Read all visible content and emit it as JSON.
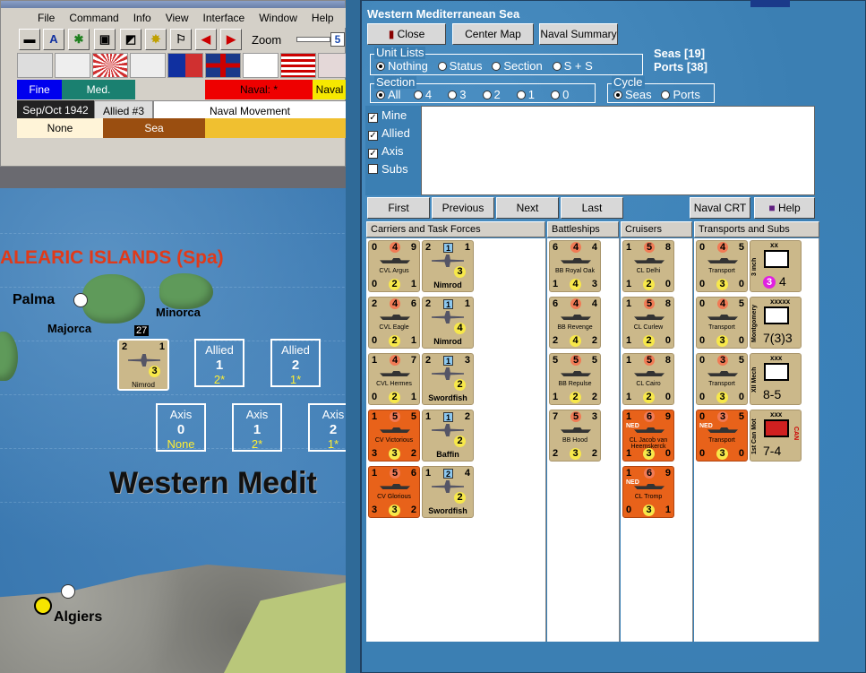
{
  "menu": {
    "items": [
      "File",
      "Command",
      "Info",
      "View",
      "Interface",
      "Window",
      "Help"
    ],
    "zoom_label": "Zoom",
    "zoom_value": "5"
  },
  "status": {
    "weather": "Fine",
    "weather2": "Med.",
    "naval": "Naval: *",
    "naval2": "Naval",
    "date": "Sep/Oct 1942",
    "impulse": "Allied #3",
    "phase": "Naval Movement",
    "none": "None",
    "sea": "Sea"
  },
  "map": {
    "region": "ALEARIC ISLANDS (Spa)",
    "palma": "Palma",
    "majorca": "Majorca",
    "minorca": "Minorca",
    "sea_name": "Western Medit",
    "algiers": "Algiers",
    "stack_count": "27",
    "boxes": [
      {
        "t": "Allied",
        "n": "1",
        "s": "2*"
      },
      {
        "t": "Allied",
        "n": "2",
        "s": "1*"
      },
      {
        "t": "Axis",
        "n": "0",
        "s": "None"
      },
      {
        "t": "Axis",
        "n": "1",
        "s": "2*"
      },
      {
        "t": "Axis",
        "n": "2",
        "s": "1*"
      }
    ],
    "nimrod_counter": {
      "tl": "2",
      "tr": "1",
      "mid": "3",
      "name": "Nimrod"
    }
  },
  "dialog": {
    "title": "Western Mediterranean Sea",
    "close": "Close",
    "center": "Center Map",
    "summary": "Naval Summary",
    "seas": "Seas [19]",
    "ports": "Ports [38]",
    "unit_lists": {
      "label": "Unit Lists",
      "options": [
        "Nothing",
        "Status",
        "Section",
        "S + S"
      ]
    },
    "section": {
      "label": "Section",
      "options": [
        "All",
        "4",
        "3",
        "2",
        "1",
        "0"
      ]
    },
    "cycle": {
      "label": "Cycle",
      "options": [
        "Seas",
        "Ports"
      ]
    },
    "checks": [
      "Mine",
      "Allied",
      "Axis",
      "Subs"
    ],
    "nav": {
      "first": "First",
      "previous": "Previous",
      "next": "Next",
      "last": "Last",
      "crt": "Naval CRT",
      "help": "Help"
    },
    "columns": [
      "Carriers and Task Forces",
      "Battleships",
      "Cruisers",
      "Transports and Subs"
    ]
  },
  "carriers": [
    {
      "tl": "0",
      "tm": "4",
      "tr": "9",
      "name": "CVL Argus",
      "bl": "0",
      "bm": "2",
      "br": "1",
      "org": false
    },
    {
      "tl": "2",
      "tm": "4",
      "tr": "6",
      "name": "CVL Eagle",
      "bl": "0",
      "bm": "2",
      "br": "1",
      "org": false
    },
    {
      "tl": "1",
      "tm": "4",
      "tr": "7",
      "name": "CVL Hermes",
      "bl": "0",
      "bm": "2",
      "br": "1",
      "org": false
    },
    {
      "tl": "1",
      "tm": "5",
      "tr": "5",
      "name": "CV Victorious",
      "bl": "3",
      "bm": "3",
      "br": "2",
      "org": true
    },
    {
      "tl": "1",
      "tm": "5",
      "tr": "6",
      "name": "CV Glorious",
      "bl": "3",
      "bm": "3",
      "br": "2",
      "org": true
    }
  ],
  "air": [
    {
      "tl": "2",
      "sq": "1",
      "tr": "1",
      "y": "3",
      "name": "Nimrod"
    },
    {
      "tl": "2",
      "sq": "1",
      "tr": "1",
      "y": "4",
      "name": "Nimrod"
    },
    {
      "tl": "2",
      "sq": "1",
      "tr": "3",
      "y": "2",
      "name": "Swordfish"
    },
    {
      "tl": "1",
      "sq": "1",
      "tr": "2",
      "y": "2",
      "name": "Baffin"
    },
    {
      "tl": "1",
      "sq": "2",
      "tr": "4",
      "y": "2",
      "name": "Swordfish"
    }
  ],
  "battleships": [
    {
      "tl": "6",
      "tm": "4",
      "tr": "4",
      "name": "BB Royal Oak",
      "bl": "1",
      "bm": "4",
      "br": "3"
    },
    {
      "tl": "6",
      "tm": "4",
      "tr": "4",
      "name": "BB Revenge",
      "bl": "2",
      "bm": "4",
      "br": "2"
    },
    {
      "tl": "5",
      "tm": "5",
      "tr": "5",
      "name": "BB Repulse",
      "bl": "1",
      "bm": "2",
      "br": "2"
    },
    {
      "tl": "7",
      "tm": "5",
      "tr": "3",
      "name": "BB Hood",
      "bl": "2",
      "bm": "3",
      "br": "2"
    }
  ],
  "cruisers": [
    {
      "tl": "1",
      "tm": "5",
      "tr": "8",
      "name": "CL Delhi",
      "bl": "1",
      "bm": "2",
      "br": "0",
      "org": false
    },
    {
      "tl": "1",
      "tm": "5",
      "tr": "8",
      "name": "CL Curlew",
      "bl": "1",
      "bm": "2",
      "br": "0",
      "org": false
    },
    {
      "tl": "1",
      "tm": "5",
      "tr": "8",
      "name": "CL Cairo",
      "bl": "1",
      "bm": "2",
      "br": "0",
      "org": false
    },
    {
      "tl": "1",
      "tm": "6",
      "tr": "9",
      "name": "CL Jacob van Heemskerck",
      "bl": "1",
      "bm": "3",
      "br": "0",
      "org": true,
      "tag": "NED"
    },
    {
      "tl": "1",
      "tm": "6",
      "tr": "9",
      "name": "CL Tromp",
      "bl": "0",
      "bm": "3",
      "br": "1",
      "org": true,
      "tag": "NED"
    }
  ],
  "transports": [
    {
      "tl": "0",
      "tm": "4",
      "tr": "5",
      "name": "Transport",
      "bl": "0",
      "bm": "3",
      "br": "0",
      "org": false
    },
    {
      "tl": "0",
      "tm": "4",
      "tr": "5",
      "name": "Transport",
      "bl": "0",
      "bm": "3",
      "br": "0",
      "org": false
    },
    {
      "tl": "0",
      "tm": "3",
      "tr": "5",
      "name": "Transport",
      "bl": "0",
      "bm": "3",
      "br": "0",
      "org": false
    },
    {
      "tl": "0",
      "tm": "3",
      "tr": "5",
      "name": "Transport",
      "bl": "0",
      "bm": "3",
      "br": "0",
      "org": true,
      "tag": "NED"
    }
  ],
  "land": [
    {
      "side": "3 inch",
      "size": "xx",
      "val": "4",
      "extra": "3"
    },
    {
      "side": "Montgomery",
      "size": "xxxxx",
      "val": "7(3)3"
    },
    {
      "side": "XII Mech",
      "size": "xxx",
      "val": "8-5"
    },
    {
      "side": "1st Can Mot",
      "size": "xxx",
      "val": "7-4",
      "tag": "CAN"
    }
  ]
}
